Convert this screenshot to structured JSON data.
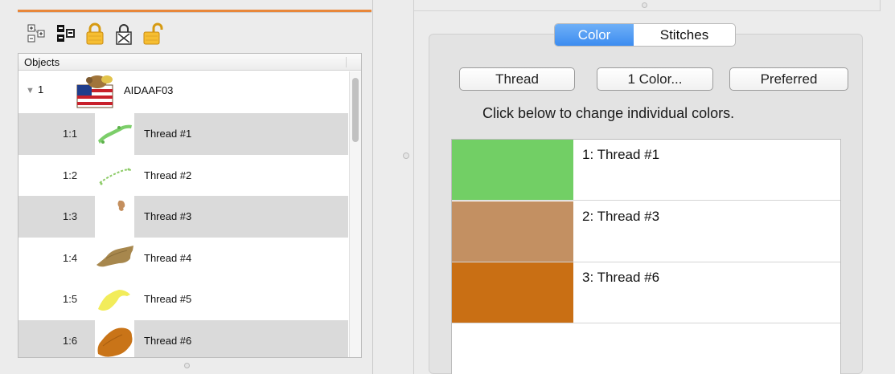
{
  "objects_panel": {
    "header": "Objects",
    "group": {
      "number": "1",
      "name": "AIDAAF03"
    },
    "rows": [
      {
        "id": "1:1",
        "name": "Thread #1",
        "color": "#7cce6a",
        "icon": "green-stitch-thumb"
      },
      {
        "id": "1:2",
        "name": "Thread #2",
        "color": "#8ccb66",
        "icon": "light-green-stitch-thumb"
      },
      {
        "id": "1:3",
        "name": "Thread #3",
        "color": "#c48f5e",
        "icon": "tan-stitch-thumb"
      },
      {
        "id": "1:4",
        "name": "Thread #4",
        "color": "#a7874d",
        "icon": "olive-stitch-thumb"
      },
      {
        "id": "1:5",
        "name": "Thread #5",
        "color": "#f2ec5a",
        "icon": "yellow-stitch-thumb"
      },
      {
        "id": "1:6",
        "name": "Thread #6",
        "color": "#c97418",
        "icon": "orange-stitch-thumb"
      }
    ]
  },
  "toolbar": {
    "icons": [
      "expand-all-icon",
      "collapse-all-icon",
      "lock-icon",
      "lock-crossed-icon",
      "unlock-icon"
    ]
  },
  "inspector": {
    "tabs": [
      {
        "label": "Color",
        "active": true
      },
      {
        "label": "Stitches",
        "active": false
      }
    ],
    "buttons": {
      "thread": "Thread",
      "one_color": "1 Color...",
      "preferred": "Preferred"
    },
    "hint": "Click below to change individual colors.",
    "colors": [
      {
        "label": "1: Thread #1",
        "color": "#72cf65"
      },
      {
        "label": "2: Thread #3",
        "color": "#c39062"
      },
      {
        "label": "3: Thread #6",
        "color": "#c96f14"
      }
    ]
  },
  "theme": {
    "accent": "#3c8cf0",
    "orange_rule": "#e8873a",
    "row_alt": "#dadada"
  }
}
